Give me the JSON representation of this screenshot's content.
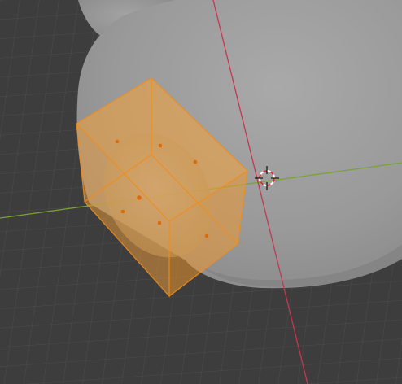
{
  "viewport": {
    "background_color": "#3d3d3d",
    "grid_color": "#4a4a4a",
    "x_axis_color": "#c4384f",
    "y_axis_color": "#7ba237",
    "mesh_color": "#9b9b9b",
    "selection_color": "#f5a236",
    "selection_outline_color": "#f28c1a",
    "vertex_color": "#e06a0a",
    "cursor_colors": [
      "#ffffff",
      "#d8293c"
    ]
  },
  "objects": [
    {
      "name": "mesh-body",
      "role": "background-shape"
    },
    {
      "name": "selected-cube",
      "role": "selected-object"
    },
    {
      "name": "3d-cursor",
      "role": "cursor"
    }
  ]
}
